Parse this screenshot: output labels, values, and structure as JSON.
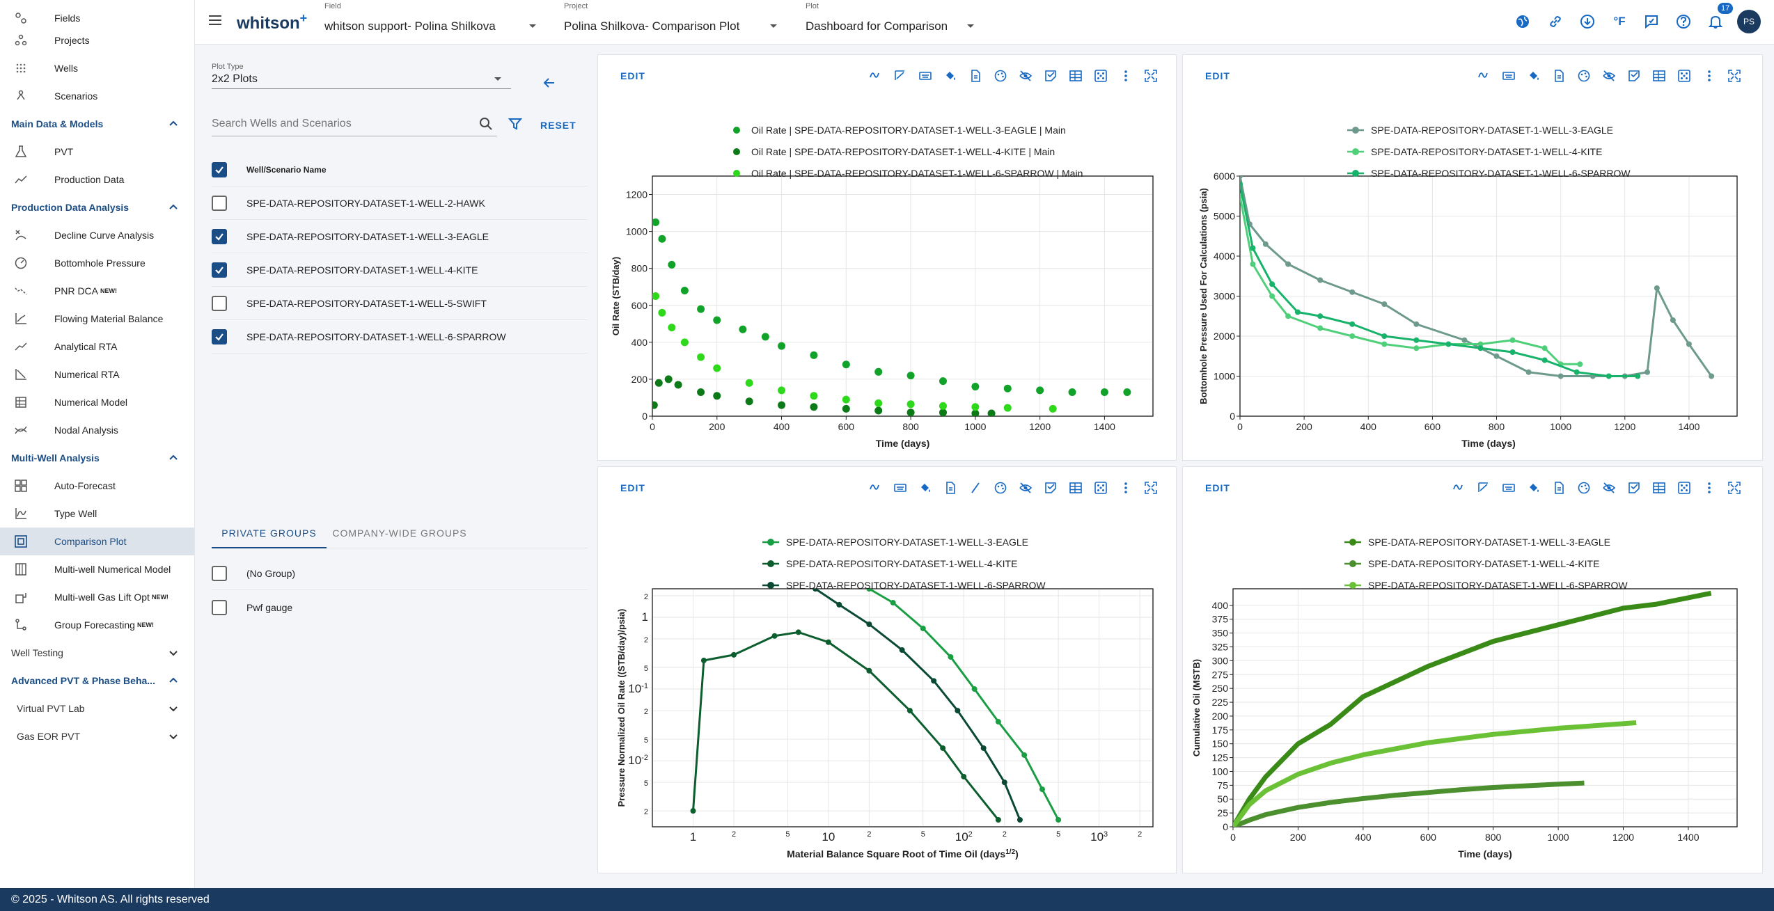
{
  "app": {
    "logo": "whitson",
    "logo_plus": "+",
    "footer": "© 2025 - Whitson AS. All rights reserved",
    "notif_count": "17",
    "avatar": "PS"
  },
  "topbar": {
    "field_label": "Field",
    "field_value": "whitson support- Polina Shilkova",
    "project_label": "Project",
    "project_value": "Polina Shilkova- Comparison Plot",
    "plot_label": "Plot",
    "plot_value": "Dashboard for Comparison"
  },
  "sidebar": {
    "top_items": [
      "Fields",
      "Projects",
      "Wells",
      "Scenarios"
    ],
    "sec_main": "Main Data & Models",
    "main_items": [
      "PVT",
      "Production Data"
    ],
    "sec_pda": "Production Data Analysis",
    "pda_items": [
      "Decline Curve Analysis",
      "Bottomhole Pressure",
      "PNR DCA",
      "Flowing Material Balance",
      "Analytical RTA",
      "Numerical RTA",
      "Numerical Model",
      "Nodal Analysis"
    ],
    "sec_mwa": "Multi-Well Analysis",
    "mwa_items": [
      "Auto-Forecast",
      "Type Well",
      "Comparison Plot",
      "Multi-well Numerical Model",
      "Multi-well Gas Lift Opt",
      "Group Forecasting"
    ],
    "new_badge": "NEW!",
    "sec_wt": "Well Testing",
    "sec_adv": "Advanced PVT & Phase Beha...",
    "sub_vpl": "Virtual PVT Lab",
    "sub_gas": "Gas EOR PVT"
  },
  "panel": {
    "plot_type_label": "Plot Type",
    "plot_type_value": "2x2 Plots",
    "search_placeholder": "Search Wells and Scenarios",
    "reset": "RESET",
    "col_header": "Well/Scenario Name",
    "wells": [
      {
        "name": "SPE-DATA-REPOSITORY-DATASET-1-WELL-2-HAWK",
        "checked": false
      },
      {
        "name": "SPE-DATA-REPOSITORY-DATASET-1-WELL-3-EAGLE",
        "checked": true
      },
      {
        "name": "SPE-DATA-REPOSITORY-DATASET-1-WELL-4-KITE",
        "checked": true
      },
      {
        "name": "SPE-DATA-REPOSITORY-DATASET-1-WELL-5-SWIFT",
        "checked": false
      },
      {
        "name": "SPE-DATA-REPOSITORY-DATASET-1-WELL-6-SPARROW",
        "checked": true
      }
    ],
    "tab_private": "PRIVATE GROUPS",
    "tab_company": "COMPANY-WIDE GROUPS",
    "groups": [
      "(No Group)",
      "Pwf gauge"
    ]
  },
  "edit_label": "EDIT",
  "chart_data": [
    {
      "type": "scatter",
      "xlabel": "Time (days)",
      "ylabel": "Oil Rate (STB/day)",
      "xlim": [
        0,
        1550
      ],
      "ylim": [
        0,
        1300
      ],
      "xticks": [
        0,
        200,
        400,
        600,
        800,
        1000,
        1200,
        1400
      ],
      "yticks": [
        0,
        200,
        400,
        600,
        800,
        1000,
        1200
      ],
      "series": [
        {
          "name": "Oil Rate | SPE-DATA-REPOSITORY-DATASET-1-WELL-3-EAGLE | Main",
          "color": "#11a329",
          "points": [
            [
              10,
              1050
            ],
            [
              30,
              960
            ],
            [
              60,
              820
            ],
            [
              100,
              680
            ],
            [
              150,
              580
            ],
            [
              200,
              520
            ],
            [
              280,
              470
            ],
            [
              350,
              430
            ],
            [
              400,
              380
            ],
            [
              500,
              330
            ],
            [
              600,
              280
            ],
            [
              700,
              240
            ],
            [
              800,
              220
            ],
            [
              900,
              190
            ],
            [
              1000,
              160
            ],
            [
              1100,
              150
            ],
            [
              1200,
              140
            ],
            [
              1300,
              130
            ],
            [
              1400,
              130
            ],
            [
              1470,
              130
            ]
          ]
        },
        {
          "name": "Oil Rate | SPE-DATA-REPOSITORY-DATASET-1-WELL-4-KITE | Main",
          "color": "#0b7a17",
          "points": [
            [
              5,
              60
            ],
            [
              20,
              180
            ],
            [
              50,
              200
            ],
            [
              80,
              170
            ],
            [
              150,
              130
            ],
            [
              200,
              110
            ],
            [
              300,
              80
            ],
            [
              400,
              60
            ],
            [
              500,
              50
            ],
            [
              600,
              40
            ],
            [
              700,
              30
            ],
            [
              800,
              20
            ],
            [
              900,
              20
            ],
            [
              1000,
              15
            ],
            [
              1050,
              15
            ]
          ]
        },
        {
          "name": "Oil Rate | SPE-DATA-REPOSITORY-DATASET-1-WELL-6-SPARROW | Main",
          "color": "#2ed81a",
          "points": [
            [
              10,
              650
            ],
            [
              30,
              560
            ],
            [
              60,
              480
            ],
            [
              100,
              400
            ],
            [
              150,
              320
            ],
            [
              200,
              260
            ],
            [
              300,
              180
            ],
            [
              400,
              140
            ],
            [
              500,
              110
            ],
            [
              600,
              90
            ],
            [
              700,
              70
            ],
            [
              800,
              65
            ],
            [
              900,
              55
            ],
            [
              1000,
              50
            ],
            [
              1100,
              45
            ],
            [
              1240,
              40
            ]
          ]
        }
      ]
    },
    {
      "type": "line",
      "xlabel": "Time (days)",
      "ylabel": "Bottomhole Pressure Used For Calculations (psia)",
      "xlim": [
        0,
        1550
      ],
      "ylim": [
        0,
        6000
      ],
      "xticks": [
        0,
        200,
        400,
        600,
        800,
        1000,
        1200,
        1400
      ],
      "yticks": [
        0,
        1000,
        2000,
        3000,
        4000,
        5000,
        6000
      ],
      "series": [
        {
          "name": "SPE-DATA-REPOSITORY-DATASET-1-WELL-3-EAGLE",
          "color": "#6d9a8c",
          "points": [
            [
              0,
              6000
            ],
            [
              30,
              4800
            ],
            [
              80,
              4300
            ],
            [
              150,
              3800
            ],
            [
              250,
              3400
            ],
            [
              350,
              3100
            ],
            [
              450,
              2800
            ],
            [
              550,
              2300
            ],
            [
              700,
              1900
            ],
            [
              800,
              1500
            ],
            [
              900,
              1100
            ],
            [
              1000,
              1000
            ],
            [
              1100,
              1000
            ],
            [
              1200,
              1000
            ],
            [
              1270,
              1100
            ],
            [
              1300,
              3200
            ],
            [
              1350,
              2400
            ],
            [
              1400,
              1800
            ],
            [
              1470,
              1000
            ]
          ]
        },
        {
          "name": "SPE-DATA-REPOSITORY-DATASET-1-WELL-4-KITE",
          "color": "#4fcf7a",
          "points": [
            [
              0,
              5500
            ],
            [
              40,
              3800
            ],
            [
              100,
              3000
            ],
            [
              150,
              2500
            ],
            [
              250,
              2200
            ],
            [
              350,
              2000
            ],
            [
              450,
              1800
            ],
            [
              550,
              1700
            ],
            [
              650,
              1800
            ],
            [
              750,
              1800
            ],
            [
              850,
              1900
            ],
            [
              950,
              1700
            ],
            [
              1000,
              1300
            ],
            [
              1060,
              1300
            ]
          ]
        },
        {
          "name": "SPE-DATA-REPOSITORY-DATASET-1-WELL-6-SPARROW",
          "color": "#17b36a",
          "points": [
            [
              0,
              5800
            ],
            [
              40,
              4200
            ],
            [
              100,
              3300
            ],
            [
              180,
              2600
            ],
            [
              250,
              2500
            ],
            [
              350,
              2300
            ],
            [
              450,
              2000
            ],
            [
              550,
              1900
            ],
            [
              650,
              1800
            ],
            [
              750,
              1700
            ],
            [
              850,
              1600
            ],
            [
              950,
              1400
            ],
            [
              1050,
              1100
            ],
            [
              1150,
              1000
            ],
            [
              1240,
              1000
            ]
          ]
        }
      ]
    },
    {
      "type": "line",
      "log": true,
      "xlabel": "Material Balance Square Root of Time Oil (days",
      "xlabel_sup": "1/2",
      "xlabel_close": ")",
      "ylabel": "Pressure Normalized Oil Rate ((STB/day)/psia)",
      "xlim": [
        0.5,
        2500
      ],
      "ylim": [
        0.0012,
        2.5
      ],
      "xtick_labels": [
        "1",
        "2",
        "5",
        "10",
        "2",
        "5",
        "10",
        "2",
        "5",
        "10",
        "2"
      ],
      "xtick_sup": [
        "",
        "",
        "",
        "",
        "",
        "",
        "2",
        "",
        "",
        "3",
        ""
      ],
      "ytick_labels": [
        "2",
        "1",
        "2",
        "5",
        "10",
        "2",
        "5",
        "10",
        "5",
        "2"
      ],
      "ytick_sup": [
        "",
        "",
        "",
        "",
        "-1",
        "",
        "",
        "-2",
        "",
        ""
      ],
      "series": [
        {
          "name": "SPE-DATA-REPOSITORY-DATASET-1-WELL-3-EAGLE",
          "color": "#1a9e44",
          "points": [
            [
              20,
              2.5
            ],
            [
              30,
              1.6
            ],
            [
              50,
              0.7
            ],
            [
              80,
              0.28
            ],
            [
              120,
              0.1
            ],
            [
              180,
              0.035
            ],
            [
              280,
              0.012
            ],
            [
              380,
              0.004
            ],
            [
              500,
              0.0015
            ]
          ]
        },
        {
          "name": "SPE-DATA-REPOSITORY-DATASET-1-WELL-4-KITE",
          "color": "#0d5e2e",
          "points": [
            [
              1,
              0.002
            ],
            [
              1.2,
              0.25
            ],
            [
              2,
              0.3
            ],
            [
              4,
              0.55
            ],
            [
              6,
              0.62
            ],
            [
              10,
              0.45
            ],
            [
              20,
              0.18
            ],
            [
              40,
              0.05
            ],
            [
              70,
              0.015
            ],
            [
              100,
              0.006
            ],
            [
              180,
              0.0015
            ]
          ]
        },
        {
          "name": "SPE-DATA-REPOSITORY-DATASET-1-WELL-6-SPARROW",
          "color": "#0a4a33",
          "points": [
            [
              8,
              2.5
            ],
            [
              12,
              1.5
            ],
            [
              20,
              0.8
            ],
            [
              35,
              0.35
            ],
            [
              60,
              0.13
            ],
            [
              90,
              0.05
            ],
            [
              140,
              0.015
            ],
            [
              200,
              0.005
            ],
            [
              260,
              0.0015
            ]
          ]
        }
      ]
    },
    {
      "type": "line",
      "xlabel": "Time (days)",
      "ylabel": "Cumulative Oil (MSTB)",
      "xlim": [
        0,
        1550
      ],
      "ylim": [
        0,
        430
      ],
      "xticks": [
        0,
        200,
        400,
        600,
        800,
        1000,
        1200,
        1400
      ],
      "yticks": [
        0,
        25,
        50,
        75,
        100,
        125,
        150,
        175,
        200,
        225,
        250,
        275,
        300,
        325,
        350,
        375,
        400
      ],
      "series": [
        {
          "name": "SPE-DATA-REPOSITORY-DATASET-1-WELL-3-EAGLE",
          "color": "#3a8a17",
          "points": [
            [
              0,
              0
            ],
            [
              50,
              50
            ],
            [
              100,
              90
            ],
            [
              200,
              150
            ],
            [
              300,
              185
            ],
            [
              400,
              235
            ],
            [
              600,
              290
            ],
            [
              800,
              335
            ],
            [
              1000,
              365
            ],
            [
              1200,
              395
            ],
            [
              1300,
              402
            ],
            [
              1470,
              422
            ]
          ]
        },
        {
          "name": "SPE-DATA-REPOSITORY-DATASET-1-WELL-4-KITE",
          "color": "#4c8f2e",
          "points": [
            [
              0,
              0
            ],
            [
              50,
              12
            ],
            [
              100,
              22
            ],
            [
              200,
              35
            ],
            [
              300,
              44
            ],
            [
              400,
              51
            ],
            [
              500,
              57
            ],
            [
              600,
              62
            ],
            [
              700,
              67
            ],
            [
              800,
              71
            ],
            [
              900,
              74
            ],
            [
              1000,
              77
            ],
            [
              1080,
              79
            ]
          ]
        },
        {
          "name": "SPE-DATA-REPOSITORY-DATASET-1-WELL-6-SPARROW",
          "color": "#6bc135",
          "points": [
            [
              0,
              0
            ],
            [
              50,
              40
            ],
            [
              100,
              65
            ],
            [
              200,
              95
            ],
            [
              300,
              115
            ],
            [
              400,
              130
            ],
            [
              600,
              152
            ],
            [
              800,
              167
            ],
            [
              1000,
              178
            ],
            [
              1240,
              188
            ]
          ]
        }
      ]
    }
  ]
}
